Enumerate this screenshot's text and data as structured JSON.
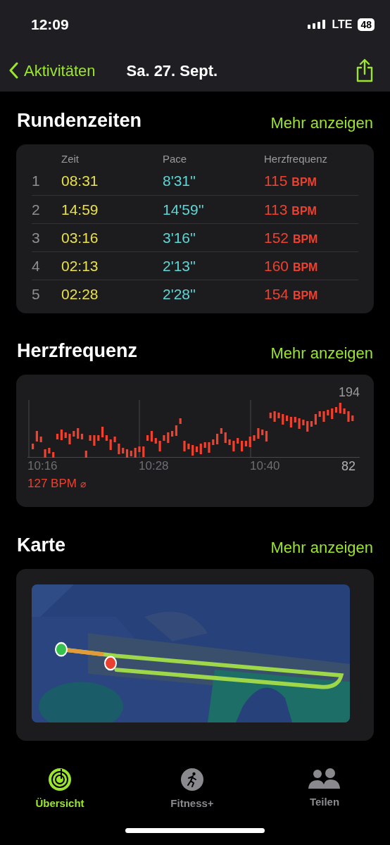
{
  "status_bar": {
    "time": "12:09",
    "network": "LTE",
    "battery": "48"
  },
  "nav": {
    "back": "Aktivitäten",
    "title": "Sa. 27. Sept."
  },
  "laps": {
    "title": "Rundenzeiten",
    "more": "Mehr anzeigen",
    "columns": [
      "Zeit",
      "Pace",
      "Herzfrequenz"
    ],
    "rows": [
      {
        "index": "1",
        "time": "08:31",
        "pace": "8'31''",
        "hr": "115",
        "unit": "BPM"
      },
      {
        "index": "2",
        "time": "14:59",
        "pace": "14'59''",
        "hr": "113",
        "unit": "BPM"
      },
      {
        "index": "3",
        "time": "03:16",
        "pace": "3'16''",
        "hr": "152",
        "unit": "BPM"
      },
      {
        "index": "4",
        "time": "02:13",
        "pace": "2'13''",
        "hr": "160",
        "unit": "BPM"
      },
      {
        "index": "5",
        "time": "02:28",
        "pace": "2'28''",
        "hr": "154",
        "unit": "BPM"
      }
    ]
  },
  "heart_rate": {
    "title": "Herzfrequenz",
    "more": "Mehr anzeigen",
    "max": "194",
    "min": "82",
    "times": [
      "10:16",
      "10:28",
      "10:40"
    ],
    "average": "127 BPM",
    "average_icon": "⌀"
  },
  "map": {
    "title": "Karte",
    "more": "Mehr anzeigen",
    "kind": "picture"
  },
  "tab_bar": [
    {
      "label": "Übersicht",
      "kind": "rings",
      "selected": true
    },
    {
      "label": "Fitness+",
      "kind": "runner",
      "selected": false
    },
    {
      "label": "Teilen",
      "kind": "people",
      "selected": false
    }
  ]
}
